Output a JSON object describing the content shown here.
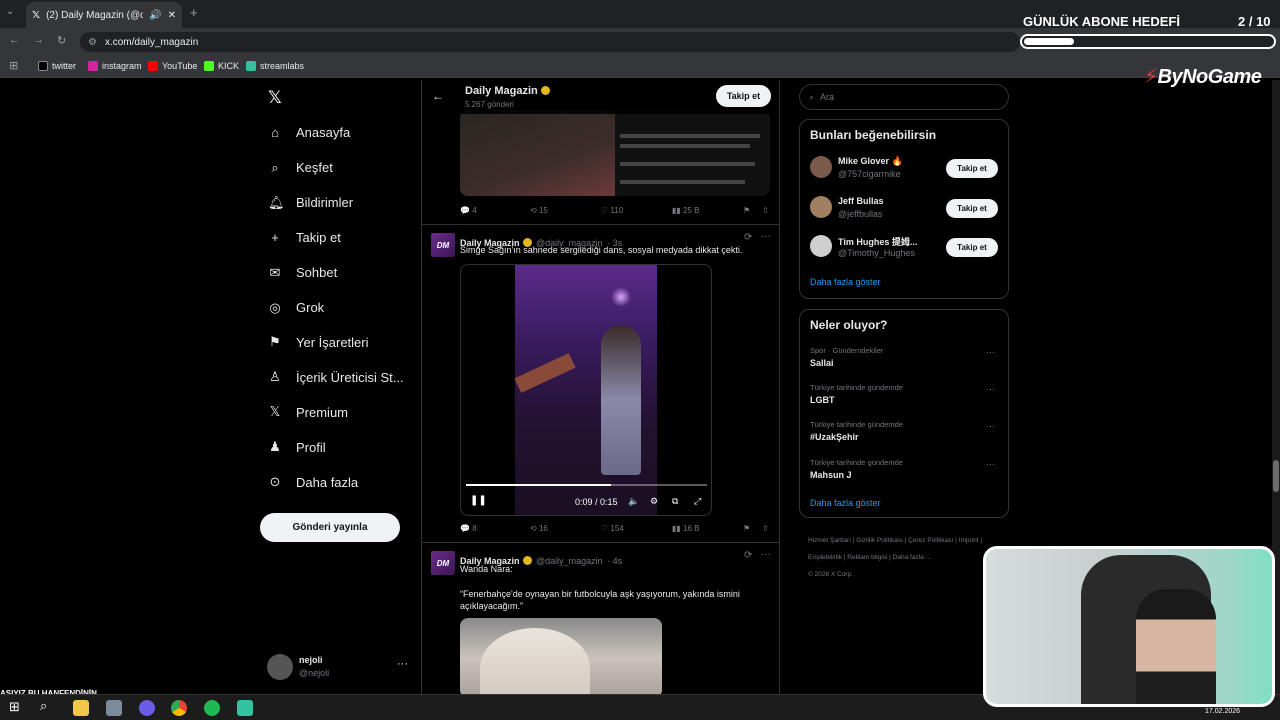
{
  "browser": {
    "tab_title": "(2) Daily Magazin (@daily_ma...",
    "url": "x.com/daily_magazin",
    "bookmarks": [
      {
        "label": "twitter",
        "color": "#000000"
      },
      {
        "label": "instagram",
        "color": "#d6249f"
      },
      {
        "label": "YouTube",
        "color": "#ff0000"
      },
      {
        "label": "KICK",
        "color": "#53fc18"
      },
      {
        "label": "streamlabs",
        "color": "#31c3a2"
      }
    ]
  },
  "overlay": {
    "goal_label": "GÜNLÜK ABONE HEDEFİ",
    "goal_count": "2 / 10",
    "goal_progress": 0.2,
    "brand": "ByNoGame",
    "ticker": "ASIYIZ BU HANFENDİNİN"
  },
  "nav": {
    "items": [
      {
        "label": "Anasayfa",
        "icon": "home-icon"
      },
      {
        "label": "Keşfet",
        "icon": "search-icon"
      },
      {
        "label": "Bildirimler",
        "icon": "bell-icon"
      },
      {
        "label": "Takip et",
        "icon": "add-user-icon"
      },
      {
        "label": "Sohbet",
        "icon": "mail-icon"
      },
      {
        "label": "Grok",
        "icon": "grok-icon"
      },
      {
        "label": "Yer İşaretleri",
        "icon": "bookmark-icon"
      },
      {
        "label": "İçerik Üreticisi St...",
        "icon": "creator-icon"
      },
      {
        "label": "Premium",
        "icon": "x-logo-icon"
      },
      {
        "label": "Profil",
        "icon": "person-icon"
      },
      {
        "label": "Daha fazla",
        "icon": "more-icon"
      }
    ],
    "post_button": "Gönderi yayınla",
    "account_name": "nejoli",
    "account_handle": "@nejoli"
  },
  "feed": {
    "profile_name": "Daily Magazin",
    "post_count": "5.267 gönderi",
    "follow_label": "Takip et",
    "tweet1": {
      "replies": "4",
      "retweets": "15",
      "likes": "110",
      "views": "25 B"
    },
    "tweet2": {
      "name": "Daily Magazin",
      "handle": "@daily_magazin",
      "time": "· 3s",
      "text": "Simge Sağın'ın sahnede sergilediği dans, sosyal medyada dikkat çekti.",
      "video_time": "0:09 / 0:15",
      "video_progress": 0.6,
      "replies": "8",
      "retweets": "16",
      "likes": "154",
      "views": "16 B"
    },
    "tweet3": {
      "name": "Daily Magazin",
      "handle": "@daily_magazin",
      "time": "· 4s",
      "line1": "Wanda Nara:",
      "line2": "“Fenerbahçe'de oynayan bir futbolcuyla aşk yaşıyorum, yakında ismini açıklayacağım.”"
    }
  },
  "sidebar": {
    "search_placeholder": "Ara",
    "suggest_title": "Bunları beğenebilirsin",
    "suggestions": [
      {
        "name": "Mike Glover 🔥",
        "handle": "@757cigarmike",
        "button": "Takip et"
      },
      {
        "name": "Jeff Bullas",
        "handle": "@jeffbullas",
        "button": "Takip et"
      },
      {
        "name": "Tim Hughes 提姆...",
        "handle": "@Timothy_Hughes",
        "button": "Takip et"
      }
    ],
    "show_more": "Daha fazla göster",
    "trends_title": "Neler oluyor?",
    "trends": [
      {
        "category": "Spor · Gündemdekiler",
        "name": "Sallai"
      },
      {
        "category": "Türkiye tarihinde gündemde",
        "name": "LGBT"
      },
      {
        "category": "Türkiye tarihinde gündemde",
        "name": "#UzakŞehir"
      },
      {
        "category": "Türkiye tarihinde gündemde",
        "name": "Mahsun J"
      }
    ],
    "trends_more": "Daha fazla göster",
    "footer": [
      "Hizmet Şartları",
      "Gizlilik Politikası",
      "Çerez Politikası",
      "Imprint",
      "Erişilebilirlik",
      "Reklam bilgisi",
      "Daha fazla ..."
    ],
    "copyright": "© 2026 X Corp."
  },
  "taskbar": {
    "date": "17.02.2026"
  },
  "colors": {
    "accent": "#1d9bf0",
    "verified_gold": "#e2b719"
  }
}
